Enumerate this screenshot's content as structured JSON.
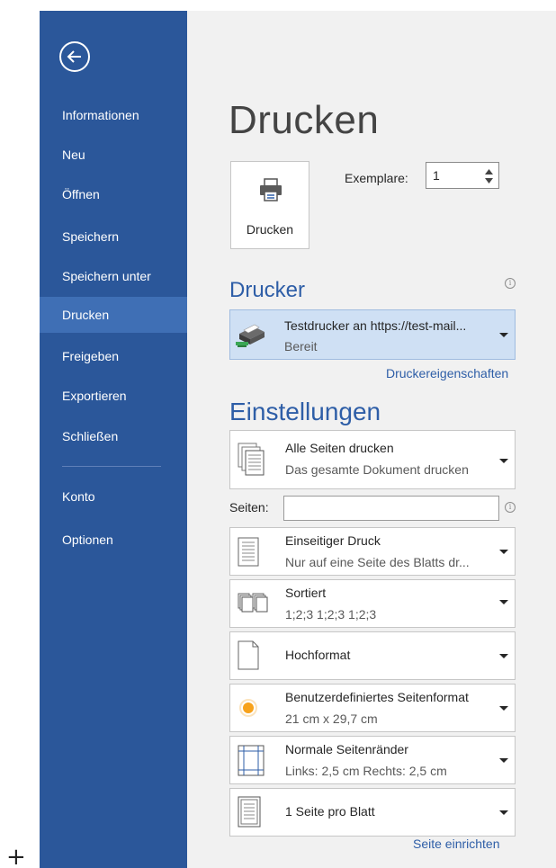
{
  "sidebar": {
    "items": [
      {
        "label": "Informationen"
      },
      {
        "label": "Neu"
      },
      {
        "label": "Öffnen"
      },
      {
        "label": "Speichern"
      },
      {
        "label": "Speichern unter"
      },
      {
        "label": "Drucken",
        "active": true
      },
      {
        "label": "Freigeben"
      },
      {
        "label": "Exportieren"
      },
      {
        "label": "Schließen"
      },
      {
        "label": "Konto"
      },
      {
        "label": "Optionen"
      }
    ]
  },
  "main": {
    "title": "Drucken",
    "print_button_label": "Drucken",
    "copies": {
      "label": "Exemplare:",
      "value": "1"
    }
  },
  "printer": {
    "heading": "Drucker",
    "name": "Testdrucker an https://test-mail...",
    "status": "Bereit",
    "properties_link": "Druckereigenschaften"
  },
  "settings": {
    "heading": "Einstellungen",
    "pages_label": "Seiten:",
    "pages_value": "",
    "items": [
      {
        "line1": "Alle Seiten drucken",
        "line2": "Das gesamte Dokument drucken",
        "icon": "pages-icon"
      },
      {
        "line1": "Einseitiger Druck",
        "line2": "Nur auf eine Seite des Blatts dr...",
        "icon": "one-sided-icon"
      },
      {
        "line1": "Sortiert",
        "line2": "1;2;3   1;2;3   1;2;3",
        "icon": "collated-icon"
      },
      {
        "line1": "Hochformat",
        "line2": "",
        "icon": "portrait-icon"
      },
      {
        "line1": "Benutzerdefiniertes Seitenformat",
        "line2": "21  cm x 29,7  cm",
        "icon": "paper-size-icon"
      },
      {
        "line1": "Normale Seitenränder",
        "line2": "Links: 2,5  cm    Rechts: 2,5  cm",
        "icon": "margins-icon"
      },
      {
        "line1": "1 Seite pro Blatt",
        "line2": "",
        "icon": "pages-per-sheet-icon"
      }
    ],
    "page_setup_link": "Seite einrichten"
  },
  "colors": {
    "sidebar": "#2b579a",
    "sidebar_active": "#3f6fb5",
    "accent": "#2e5ea7",
    "printer_selected": "#cfe0f4"
  }
}
